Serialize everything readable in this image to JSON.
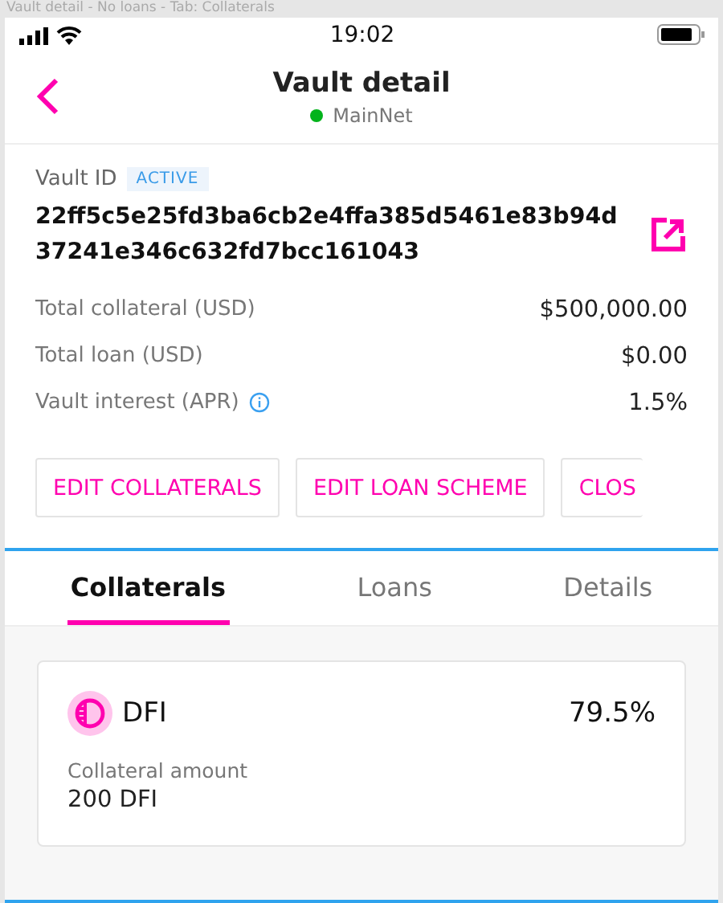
{
  "caption": "Vault detail - No loans - Tab: Collaterals",
  "status_bar": {
    "time": "19:02"
  },
  "header": {
    "title": "Vault detail",
    "network": "MainNet"
  },
  "vault": {
    "id_label": "Vault ID",
    "status": "ACTIVE",
    "id": "22ff5c5e25fd3ba6cb2e4ffa385d5461e83b94d37241e346c632fd7bcc161043",
    "rows": [
      {
        "label": "Total collateral (USD)",
        "value": "$500,000.00",
        "info": false
      },
      {
        "label": "Total loan (USD)",
        "value": "$0.00",
        "info": false
      },
      {
        "label": "Vault interest (APR)",
        "value": "1.5%",
        "info": true
      }
    ]
  },
  "actions": [
    "EDIT COLLATERALS",
    "EDIT LOAN SCHEME",
    "CLOS"
  ],
  "tabs": [
    {
      "label": "Collaterals",
      "selected": true
    },
    {
      "label": "Loans",
      "selected": false
    },
    {
      "label": "Details",
      "selected": false
    }
  ],
  "collaterals": [
    {
      "token": "DFI",
      "share": "79.5%",
      "amount_label": "Collateral amount",
      "amount": "200 DFI"
    }
  ]
}
